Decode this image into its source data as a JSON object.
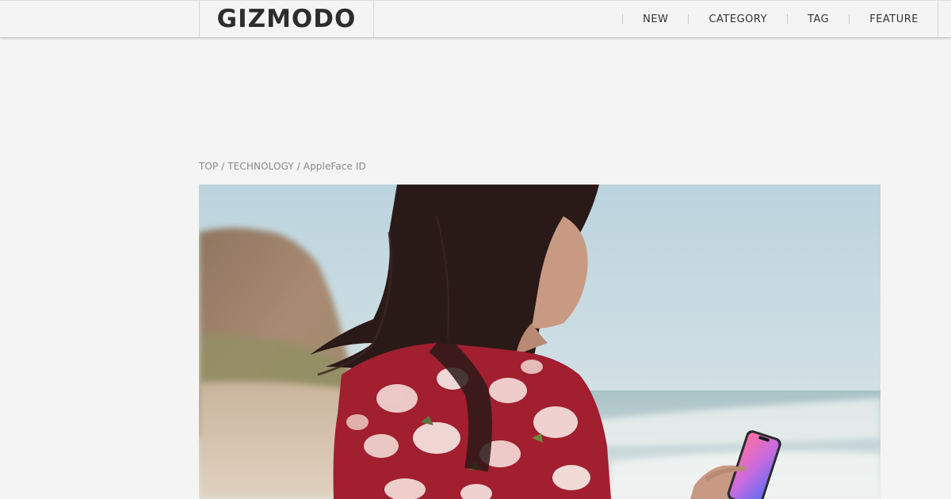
{
  "brand": {
    "logo_text": "GIZMODO"
  },
  "nav": {
    "items": [
      {
        "label": "NEW"
      },
      {
        "label": "CATEGORY"
      },
      {
        "label": "TAG"
      },
      {
        "label": "FEATURE"
      }
    ]
  },
  "breadcrumb": {
    "items": [
      {
        "label": "TOP"
      },
      {
        "label": "TECHNOLOGY"
      },
      {
        "label": "AppleFace ID"
      }
    ],
    "separator": "/"
  },
  "hero": {
    "icon": "photo-woman-with-iphone"
  },
  "colors": {
    "background": "#f4f4f4",
    "text": "#333333",
    "muted": "#888888"
  }
}
